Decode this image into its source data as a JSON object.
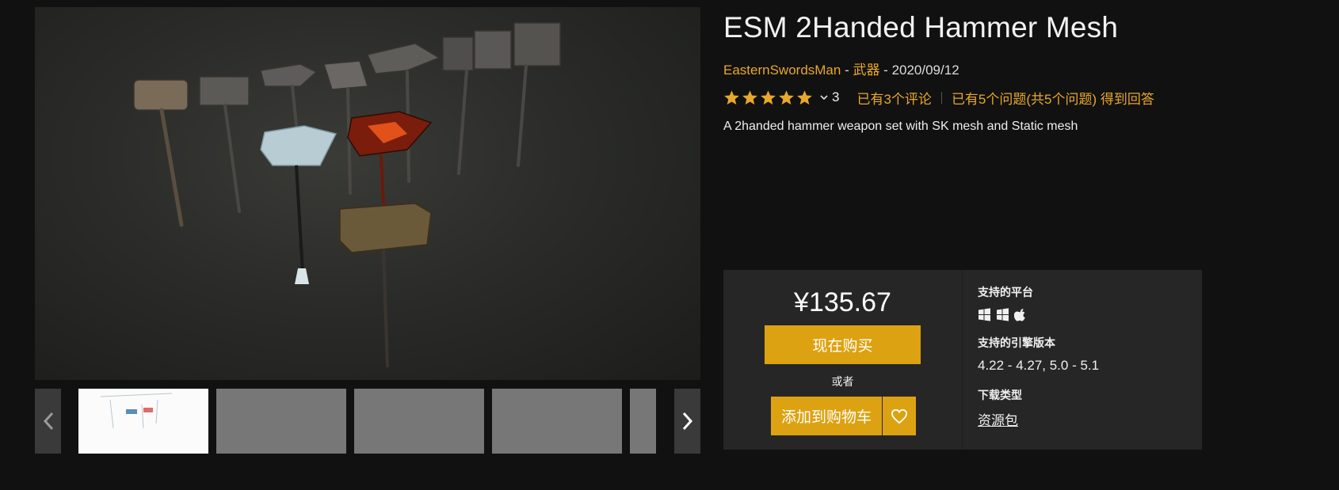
{
  "product": {
    "title": "ESM 2Handed Hammer Mesh",
    "author": "EasternSwordsMan",
    "category": "武器",
    "date": "2020/09/12",
    "separator": " - ",
    "rating_count": "3",
    "reviews_link": "已有3个评论",
    "questions_link": "已有5个问题(共5个问题) 得到回答",
    "description": "A 2handed hammer weapon set with SK mesh and Static mesh",
    "stars": 5
  },
  "purchase": {
    "price": "¥135.67",
    "buy_now": "现在购买",
    "or": "或者",
    "add_to_cart": "添加到购物车"
  },
  "specs": {
    "platforms_label": "支持的平台",
    "platform_icons": [
      "windows-icon",
      "windows-icon",
      "apple-icon"
    ],
    "engine_label": "支持的引擎版本",
    "engine_versions": "4.22 - 4.27, 5.0 - 5.1",
    "download_label": "下载类型",
    "download_type": "资源包"
  },
  "colors": {
    "accent": "#e8a82a",
    "button": "#dda211",
    "background": "#111111",
    "panel": "#262626"
  },
  "gallery": {
    "thumbnail_count": 5,
    "active_index": 0
  }
}
